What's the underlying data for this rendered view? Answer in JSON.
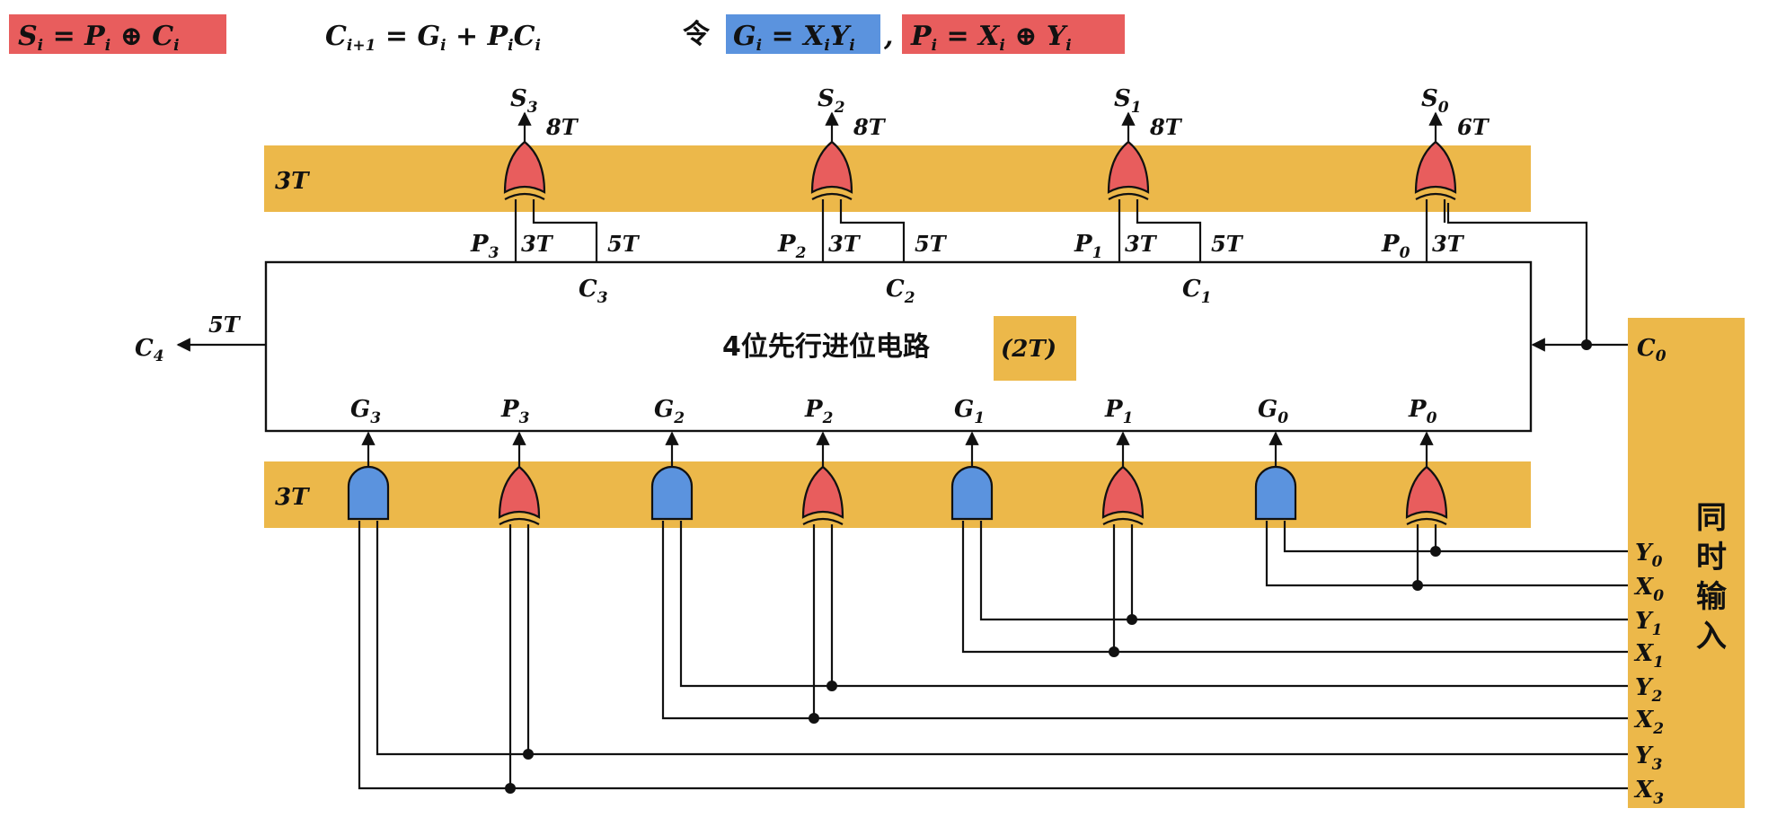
{
  "formulas": {
    "sum": "S",
    "sum_sub": "i",
    "sum_rest": " = P",
    "sum_rest_sub": "i",
    "sum_tail": " ⊕ C",
    "sum_tail_sub": "i",
    "carry": "C",
    "carry_sub": "i+1",
    "carry_rest": " = G",
    "carry_rest_sub": "i",
    "carry_mid": " + P",
    "carry_mid_sub": "i",
    "carry_tail": "C",
    "carry_tail_sub": "i",
    "let_label": "令",
    "g_def": "G",
    "g_def_sub": "i",
    "g_def_rest": " = X",
    "g_def_rest_sub": "i",
    "g_def_tail": "Y",
    "g_def_tail_sub": "i",
    "comma": ",",
    "p_def": "P",
    "p_def_sub": "i",
    "p_def_rest": " = X",
    "p_def_rest_sub": "i",
    "p_def_tail": " ⊕ Y",
    "p_def_tail_sub": "i"
  },
  "bands": {
    "top_delay": "3T",
    "bottom_delay": "3T"
  },
  "outputs": [
    {
      "name": "S",
      "sub": "3",
      "delay": "8T"
    },
    {
      "name": "S",
      "sub": "2",
      "delay": "8T"
    },
    {
      "name": "S",
      "sub": "1",
      "delay": "8T"
    },
    {
      "name": "S",
      "sub": "0",
      "delay": "6T"
    }
  ],
  "top_inputs": [
    {
      "p": "P",
      "p_sub": "3",
      "p_delay": "3T",
      "c_delay": "5T",
      "c": "C",
      "c_sub": "3"
    },
    {
      "p": "P",
      "p_sub": "2",
      "p_delay": "3T",
      "c_delay": "5T",
      "c": "C",
      "c_sub": "2"
    },
    {
      "p": "P",
      "p_sub": "1",
      "p_delay": "3T",
      "c_delay": "5T",
      "c": "C",
      "c_sub": "1"
    },
    {
      "p": "P",
      "p_sub": "0",
      "p_delay": "3T"
    }
  ],
  "cla": {
    "title": "4位先行进位电路",
    "delay": "(2T)",
    "carry_out": "C",
    "carry_out_sub": "4",
    "carry_out_delay": "5T",
    "carry_in": "C",
    "carry_in_sub": "0"
  },
  "gp_inputs": [
    {
      "name": "G",
      "sub": "3",
      "gate": "and"
    },
    {
      "name": "P",
      "sub": "3",
      "gate": "xor"
    },
    {
      "name": "G",
      "sub": "2",
      "gate": "and"
    },
    {
      "name": "P",
      "sub": "2",
      "gate": "xor"
    },
    {
      "name": "G",
      "sub": "1",
      "gate": "and"
    },
    {
      "name": "P",
      "sub": "1",
      "gate": "xor"
    },
    {
      "name": "G",
      "sub": "0",
      "gate": "and"
    },
    {
      "name": "P",
      "sub": "0",
      "gate": "xor"
    }
  ],
  "xy_inputs": [
    {
      "name": "Y",
      "sub": "0"
    },
    {
      "name": "X",
      "sub": "0"
    },
    {
      "name": "Y",
      "sub": "1"
    },
    {
      "name": "X",
      "sub": "1"
    },
    {
      "name": "Y",
      "sub": "2"
    },
    {
      "name": "X",
      "sub": "2"
    },
    {
      "name": "Y",
      "sub": "3"
    },
    {
      "name": "X",
      "sub": "3"
    }
  ],
  "side_label": [
    "同",
    "时",
    "输",
    "入"
  ],
  "colors": {
    "band": "#ECB84A",
    "red": "#E85D5D",
    "blue": "#5B93DE",
    "text": "#111111"
  }
}
